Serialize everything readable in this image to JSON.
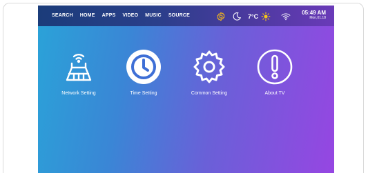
{
  "nav": [
    {
      "label": "SEARCH"
    },
    {
      "label": "HOME"
    },
    {
      "label": "APPS"
    },
    {
      "label": "VIDEO"
    },
    {
      "label": "MUSIC"
    },
    {
      "label": "SOURCE"
    }
  ],
  "status": {
    "temperature": "7°C",
    "time": "05:49 AM",
    "date": "Mon,01.18",
    "icons": [
      "gear-icon",
      "moon-icon",
      "sun-icon",
      "wifi-icon"
    ]
  },
  "tiles": [
    {
      "label": "Network Setting",
      "icon": "router-icon"
    },
    {
      "label": "Time Setting",
      "icon": "clock-icon"
    },
    {
      "label": "Common Setting",
      "icon": "gear-icon"
    },
    {
      "label": "About TV",
      "icon": "info-icon"
    }
  ],
  "colors": {
    "accent_gear": "#f2b51c",
    "sun": "#f5c518",
    "gradient_start": "#2aa3d8",
    "gradient_end": "#9646e2"
  }
}
